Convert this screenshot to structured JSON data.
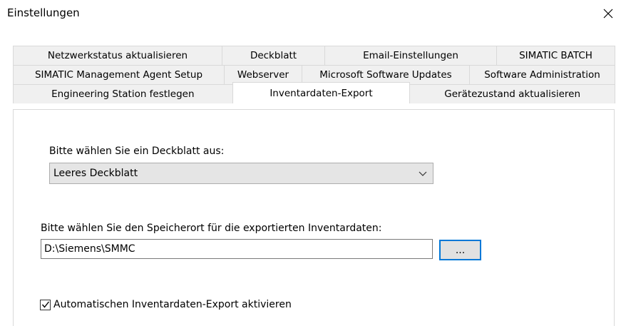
{
  "window": {
    "title": "Einstellungen"
  },
  "tabs": {
    "row1": [
      "Netzwerkstatus aktualisieren",
      "Deckblatt",
      "Email-Einstellungen",
      "SIMATIC BATCH"
    ],
    "row2": [
      "SIMATIC Management Agent Setup",
      "Webserver",
      "Microsoft Software Updates",
      "Software Administration"
    ],
    "row3": [
      "Engineering Station festlegen",
      "Inventardaten-Export",
      "Gerätezustand aktualisieren"
    ],
    "active": "Inventardaten-Export"
  },
  "panel": {
    "cover_label": "Bitte wählen Sie ein Deckblatt aus:",
    "cover_value": "Leeres Deckblatt",
    "location_label": "Bitte wählen Sie den Speicherort für die exportierten Inventardaten:",
    "location_value": "D:\\Siemens\\SMMC",
    "browse_label": "...",
    "auto_export_label": "Automatischen Inventardaten-Export aktivieren",
    "auto_export_checked": true
  },
  "icons": {
    "close": "close-icon",
    "dropdown": "chevron-down-icon",
    "checkmark": "checkmark-icon"
  },
  "colors": {
    "focus_border": "#0078d7",
    "combo_bg": "#e5e5e5",
    "tab_bg": "#f0f0f0"
  }
}
